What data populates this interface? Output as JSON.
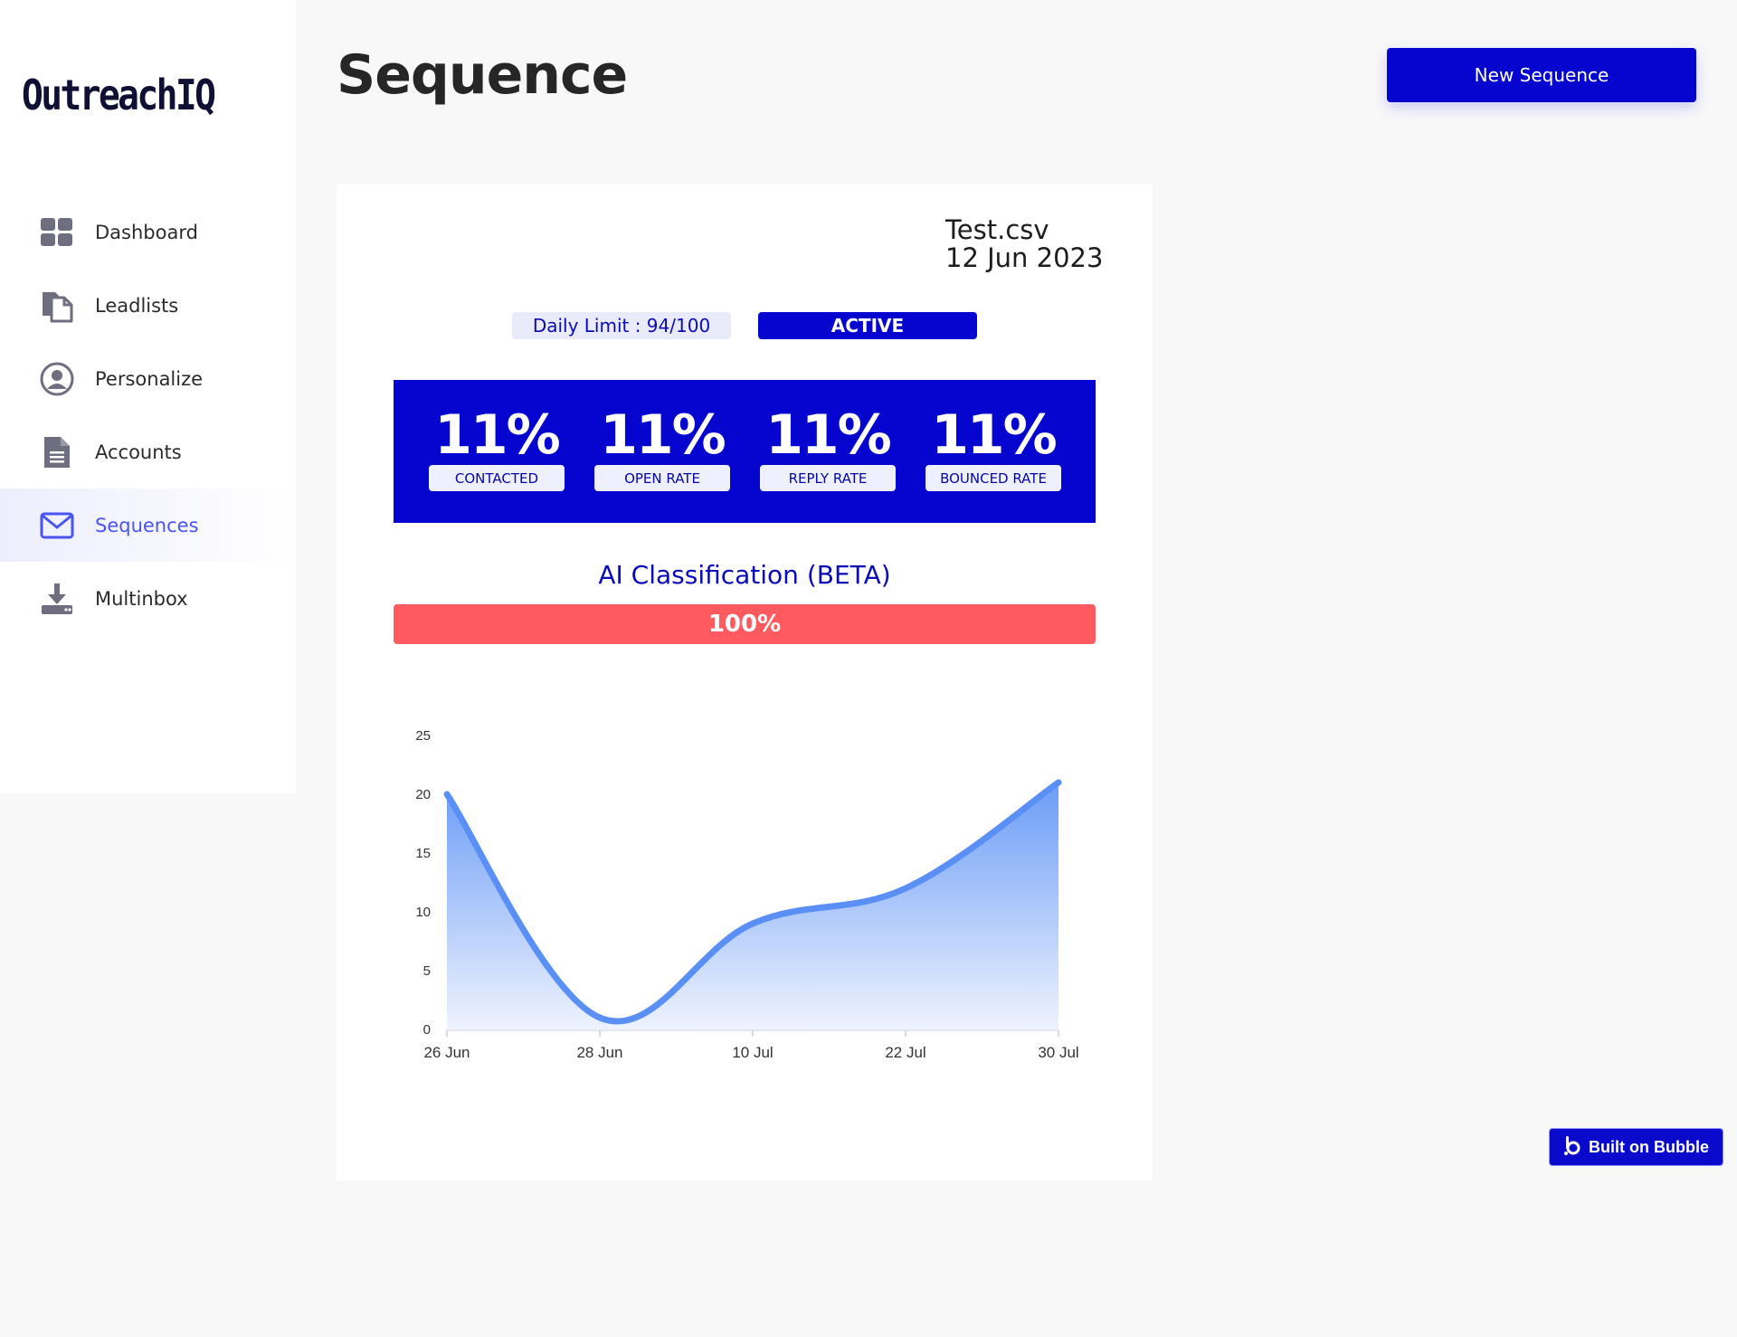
{
  "app": {
    "name": "OutreachIQ"
  },
  "sidebar": {
    "items": [
      {
        "label": "Dashboard",
        "icon": "dashboard-grid-icon",
        "active": false
      },
      {
        "label": "Leadlists",
        "icon": "copy-document-icon",
        "active": false
      },
      {
        "label": "Personalize",
        "icon": "user-circle-icon",
        "active": false
      },
      {
        "label": "Accounts",
        "icon": "file-text-icon",
        "active": false
      },
      {
        "label": "Sequences",
        "icon": "envelope-icon",
        "active": true
      },
      {
        "label": "Multinbox",
        "icon": "download-tray-icon",
        "active": false
      }
    ]
  },
  "header": {
    "title": "Sequence",
    "new_button_label": "New Sequence"
  },
  "card": {
    "file_name": "Test.csv",
    "file_date": "12 Jun 2023",
    "daily_limit": "Daily Limit : 94/100",
    "status": "ACTIVE",
    "stats": [
      {
        "value": "11%",
        "label": "CONTACTED"
      },
      {
        "value": "11%",
        "label": "OPEN RATE"
      },
      {
        "value": "11%",
        "label": "REPLY RATE"
      },
      {
        "value": "11%",
        "label": "BOUNCED RATE"
      }
    ],
    "ai_title": "AI Classification (BETA)",
    "ai_value": "100%",
    "ai_fraction": 1.0
  },
  "chart_data": {
    "type": "area",
    "categories": [
      "26 Jun",
      "28 Jun",
      "10 Jul",
      "22 Jul",
      "30 Jul"
    ],
    "values": [
      20,
      1,
      9,
      12,
      21
    ],
    "ylim": [
      0,
      25
    ],
    "yticks": [
      0,
      5,
      10,
      15,
      20,
      25
    ],
    "grid": false,
    "colors": {
      "line": "#5a8ff5",
      "fill_top": "#6b9cf6",
      "fill_bottom": "#eef3fe"
    }
  },
  "badge": {
    "label": "Built on Bubble",
    "icon": "bubble-logo-icon"
  },
  "colors": {
    "brand": "#0505cf",
    "accent": "#4a54f2",
    "danger": "#ff5a5f"
  }
}
